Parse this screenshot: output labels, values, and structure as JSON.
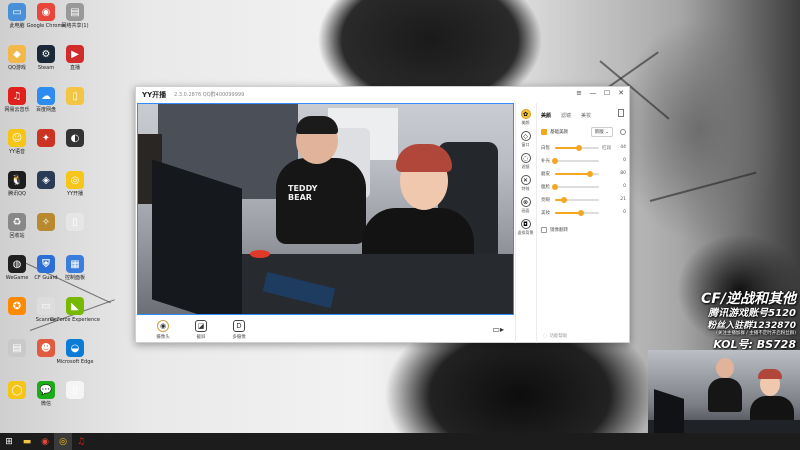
{
  "desktop": {
    "icons": [
      {
        "label": "此电脑",
        "icon": "computer-icon",
        "color": "#4a90d9",
        "glyph": "▭"
      },
      {
        "label": "Google Chrome",
        "icon": "chrome-icon",
        "color": "#e8453c",
        "glyph": "◉"
      },
      {
        "label": "网络共享(1)",
        "icon": "network-icon",
        "color": "#999999",
        "glyph": "▤"
      },
      {
        "label": "QQ游戏",
        "icon": "qq-game-icon",
        "color": "#f2b84a",
        "glyph": "◆"
      },
      {
        "label": "Steam",
        "icon": "steam-icon",
        "color": "#1b2838",
        "glyph": "⚙"
      },
      {
        "label": "直播",
        "icon": "live-icon",
        "color": "#d12b2b",
        "glyph": "▶"
      },
      {
        "label": "网易云音乐",
        "icon": "netease-music-icon",
        "color": "#e0201c",
        "glyph": "♫"
      },
      {
        "label": "百度网盘",
        "icon": "baidu-netdisk-icon",
        "color": "#2e8bf0",
        "glyph": "☁"
      },
      {
        "label": "",
        "icon": "file-icon",
        "color": "#f4c542",
        "glyph": "▯"
      },
      {
        "label": "YY语音",
        "icon": "yy-icon",
        "color": "#f5c518",
        "glyph": "☺"
      },
      {
        "label": "",
        "icon": "game-icon",
        "color": "#cc3322",
        "glyph": "✦"
      },
      {
        "label": "",
        "icon": "app-icon",
        "color": "#333333",
        "glyph": "◐"
      },
      {
        "label": "腾讯QQ",
        "icon": "qq-icon",
        "color": "#1d1d1d",
        "glyph": "🐧"
      },
      {
        "label": "",
        "icon": "game-launcher-icon",
        "color": "#2b3b55",
        "glyph": "◈"
      },
      {
        "label": "YY开播",
        "icon": "yy-live-icon",
        "color": "#f5c518",
        "glyph": "◎"
      },
      {
        "label": "回收站",
        "icon": "recycle-bin-icon",
        "color": "#888888",
        "glyph": "♻"
      },
      {
        "label": "",
        "icon": "cf-icon",
        "color": "#b8892e",
        "glyph": "✧"
      },
      {
        "label": "",
        "icon": "blank-file-icon",
        "color": "#e6e6e6",
        "glyph": "▯"
      },
      {
        "label": "WeGame",
        "icon": "wegame-icon",
        "color": "#202020",
        "glyph": "◍"
      },
      {
        "label": "CF Guard",
        "icon": "cf-guard-icon",
        "color": "#2c6fd6",
        "glyph": "⛨"
      },
      {
        "label": "控制面板",
        "icon": "control-panel-icon",
        "color": "#3b7ddd",
        "glyph": "▦"
      },
      {
        "label": "",
        "icon": "tool-icon",
        "color": "#ff8a00",
        "glyph": "✪"
      },
      {
        "label": "Scanner",
        "icon": "scanner-icon",
        "color": "#dddddd",
        "glyph": "▭"
      },
      {
        "label": "GeForce Experience",
        "icon": "geforce-icon",
        "color": "#76b900",
        "glyph": "◣"
      },
      {
        "label": "",
        "icon": "doc-icon",
        "color": "#c9c9c9",
        "glyph": "▤"
      },
      {
        "label": "",
        "icon": "mascot-icon",
        "color": "#e25b3f",
        "glyph": "☻"
      },
      {
        "label": "Microsoft Edge",
        "icon": "edge-icon",
        "color": "#0c7bd6",
        "glyph": "◒"
      },
      {
        "label": "",
        "icon": "yy-tool-icon",
        "color": "#f5c518",
        "glyph": "◯"
      },
      {
        "label": "微信",
        "icon": "wechat-icon",
        "color": "#1aad19",
        "glyph": "💬"
      },
      {
        "label": "",
        "icon": "text-file-icon",
        "color": "#f5f5f5",
        "glyph": "▯"
      }
    ]
  },
  "app": {
    "title": "YY开播",
    "version": "2.3.0.2876 QQ群400099999",
    "window_controls": [
      "≡",
      "—",
      "☐",
      "✕"
    ],
    "preview": {
      "shirt_text_line1": "TEDDY",
      "shirt_text_line2": "BEAR"
    },
    "bottom_tools": [
      {
        "label": "摄像头",
        "icon": "camera-icon",
        "glyph": "◉"
      },
      {
        "label": "截屏",
        "icon": "screenshot-icon",
        "glyph": "◪"
      },
      {
        "label": "多摄像",
        "icon": "multi-camera-icon",
        "glyph": "D"
      }
    ],
    "camera_toggle": "▭▸",
    "side_menu": [
      {
        "label": "美颜",
        "icon": "beauty-icon",
        "glyph": "✿",
        "active": true
      },
      {
        "label": "窗口",
        "icon": "window-icon",
        "glyph": "◇",
        "active": false
      },
      {
        "label": "滤镜",
        "icon": "filter-icon",
        "glyph": "◌",
        "active": false
      },
      {
        "label": "特效",
        "icon": "effects-icon",
        "glyph": "✕",
        "active": false
      },
      {
        "label": "画面",
        "icon": "screen-icon",
        "glyph": "⊗",
        "active": false
      },
      {
        "label": "虚拟背景",
        "icon": "virtual-bg-icon",
        "glyph": "◘",
        "active": false
      }
    ],
    "panel": {
      "tabs": [
        "美颜",
        "滤镜",
        "美妆"
      ],
      "active_tab": 0,
      "beauty_toggle_label": "基础美颜",
      "mode_value": "新版",
      "sliders": [
        {
          "label": "白皙",
          "extra": "红润",
          "value": 44,
          "fraction": 0.55
        },
        {
          "label": "补光",
          "extra": "",
          "value": 0,
          "fraction": 0.0
        },
        {
          "label": "磨皮",
          "extra": "",
          "value": 80,
          "fraction": 0.8
        },
        {
          "label": "瘦脸",
          "extra": "",
          "value": 0,
          "fraction": 0.0
        },
        {
          "label": "亮眼",
          "extra": "",
          "value": 21,
          "fraction": 0.21
        },
        {
          "label": "美妆",
          "extra": "",
          "value": 0,
          "fraction": 0.6
        }
      ],
      "mirror_label": "镜像翻转",
      "feedback_label": "功能帮助"
    }
  },
  "overlay": {
    "line1": "CF/逆战和其他",
    "line2": "腾讯游戏账号5120",
    "line3": "粉丝入驻群1232870",
    "line4": "(关注主播加群 / 主播不定时开启粉丝群)",
    "line5": "KOL号: BS728"
  },
  "taskbar": {
    "items": [
      {
        "icon": "windows-start-icon",
        "glyph": "⊞",
        "color": "#ffffff"
      },
      {
        "icon": "file-explorer-icon",
        "glyph": "▬",
        "color": "#f4c542"
      },
      {
        "icon": "chrome-taskbar-icon",
        "glyph": "◉",
        "color": "#e8453c"
      },
      {
        "icon": "yy-taskbar-icon",
        "glyph": "◎",
        "color": "#f5c518"
      },
      {
        "icon": "netease-taskbar-icon",
        "glyph": "♫",
        "color": "#e0201c"
      }
    ]
  }
}
